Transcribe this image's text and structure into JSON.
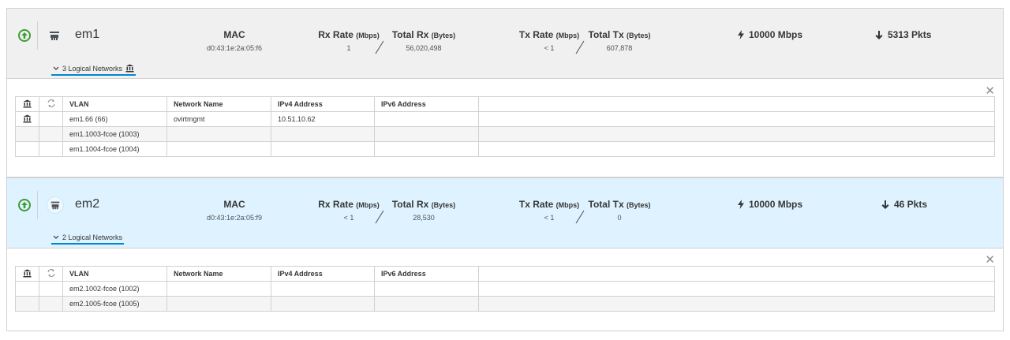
{
  "nics": [
    {
      "name": "em1",
      "mac_label": "MAC",
      "mac": "d0:43:1e:2a:05:f6",
      "rx_rate_label": "Rx Rate",
      "rx_rate_unit": "(Mbps)",
      "rx_rate": "1",
      "total_rx_label": "Total Rx",
      "total_rx_unit": "(Bytes)",
      "total_rx": "56,020,498",
      "tx_rate_label": "Tx Rate",
      "tx_rate_unit": "(Mbps)",
      "tx_rate": "< 1",
      "total_tx_label": "Total Tx",
      "total_tx_unit": "(Bytes)",
      "total_tx": "607,878",
      "speed": "10000 Mbps",
      "packets": "5313 Pkts",
      "logical_networks_label": "3 Logical Networks",
      "status_icon": "up-arrow-icon",
      "table": {
        "headers": [
          "VLAN",
          "Network Name",
          "IPv4 Address",
          "IPv6 Address"
        ],
        "rows": [
          {
            "vlan": "em1.66 (66)",
            "network": "ovirtmgmt",
            "ipv4": "10.51.10.62",
            "ipv6": "",
            "has_icon": true
          },
          {
            "vlan": "em1.1003-fcoe (1003)",
            "network": "",
            "ipv4": "",
            "ipv6": "",
            "has_icon": false
          },
          {
            "vlan": "em1.1004-fcoe (1004)",
            "network": "",
            "ipv4": "",
            "ipv6": "",
            "has_icon": false
          }
        ]
      }
    },
    {
      "name": "em2",
      "mac_label": "MAC",
      "mac": "d0:43:1e:2a:05:f9",
      "rx_rate_label": "Rx Rate",
      "rx_rate_unit": "(Mbps)",
      "rx_rate": "< 1",
      "total_rx_label": "Total Rx",
      "total_rx_unit": "(Bytes)",
      "total_rx": "28,530",
      "tx_rate_label": "Tx Rate",
      "tx_rate_unit": "(Mbps)",
      "tx_rate": "< 1",
      "total_tx_label": "Total Tx",
      "total_tx_unit": "(Bytes)",
      "total_tx": "0",
      "speed": "10000 Mbps",
      "packets": "46 Pkts",
      "logical_networks_label": "2 Logical Networks",
      "status_icon": "up-arrow-icon",
      "table": {
        "headers": [
          "VLAN",
          "Network Name",
          "IPv4 Address",
          "IPv6 Address"
        ],
        "rows": [
          {
            "vlan": "em2.1002-fcoe (1002)",
            "network": "",
            "ipv4": "",
            "ipv6": "",
            "has_icon": false
          },
          {
            "vlan": "em2.1005-fcoe (1005)",
            "network": "",
            "ipv4": "",
            "ipv6": "",
            "has_icon": false
          }
        ]
      }
    }
  ],
  "close_glyph": "✕",
  "colors": {
    "status_up": "#3f9c35",
    "accent": "#0088ce",
    "selected_header_bg": "#def3ff",
    "header_bg": "#f0f0f0"
  }
}
